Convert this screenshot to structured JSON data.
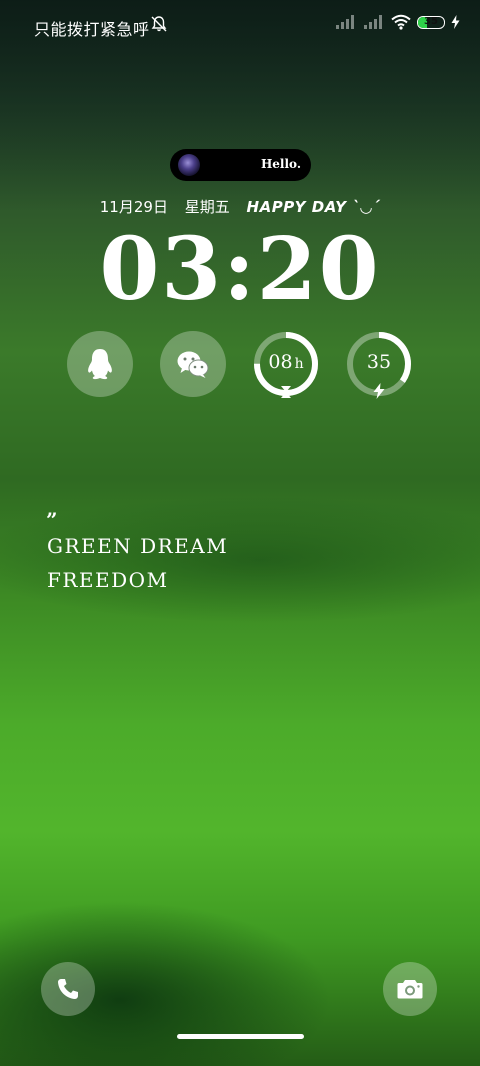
{
  "status_bar": {
    "carrier_text": "只能拨打紧急呼",
    "battery_level": "35",
    "battery_fraction": 0.35,
    "icons": [
      "bell-off-icon",
      "signal-icon",
      "signal-icon",
      "wifi-icon",
      "battery-icon",
      "charging-bolt-icon"
    ]
  },
  "notification_pill": {
    "text": "Hello."
  },
  "lockscreen": {
    "date": "11月29日",
    "weekday": "星期五",
    "tagline": "HAPPY DAY ˋ◡ˊ",
    "time": "03:20"
  },
  "widgets": {
    "qq_icon": "qq-penguin-icon",
    "wechat_icon": "wechat-icon",
    "hours_value": "08",
    "hours_unit": "h",
    "hours_progress": 0.75,
    "battery_value": "35",
    "battery_progress": 0.35
  },
  "quote": {
    "mark": "”",
    "line1": "GREEN  DREAM",
    "line2": "FREEDOM"
  },
  "shortcuts": {
    "left_icon": "phone-icon",
    "right_icon": "camera-icon"
  },
  "colors": {
    "battery_fill": "#2fd24a",
    "widget_bg": "rgba(255,255,255,0.28)"
  }
}
